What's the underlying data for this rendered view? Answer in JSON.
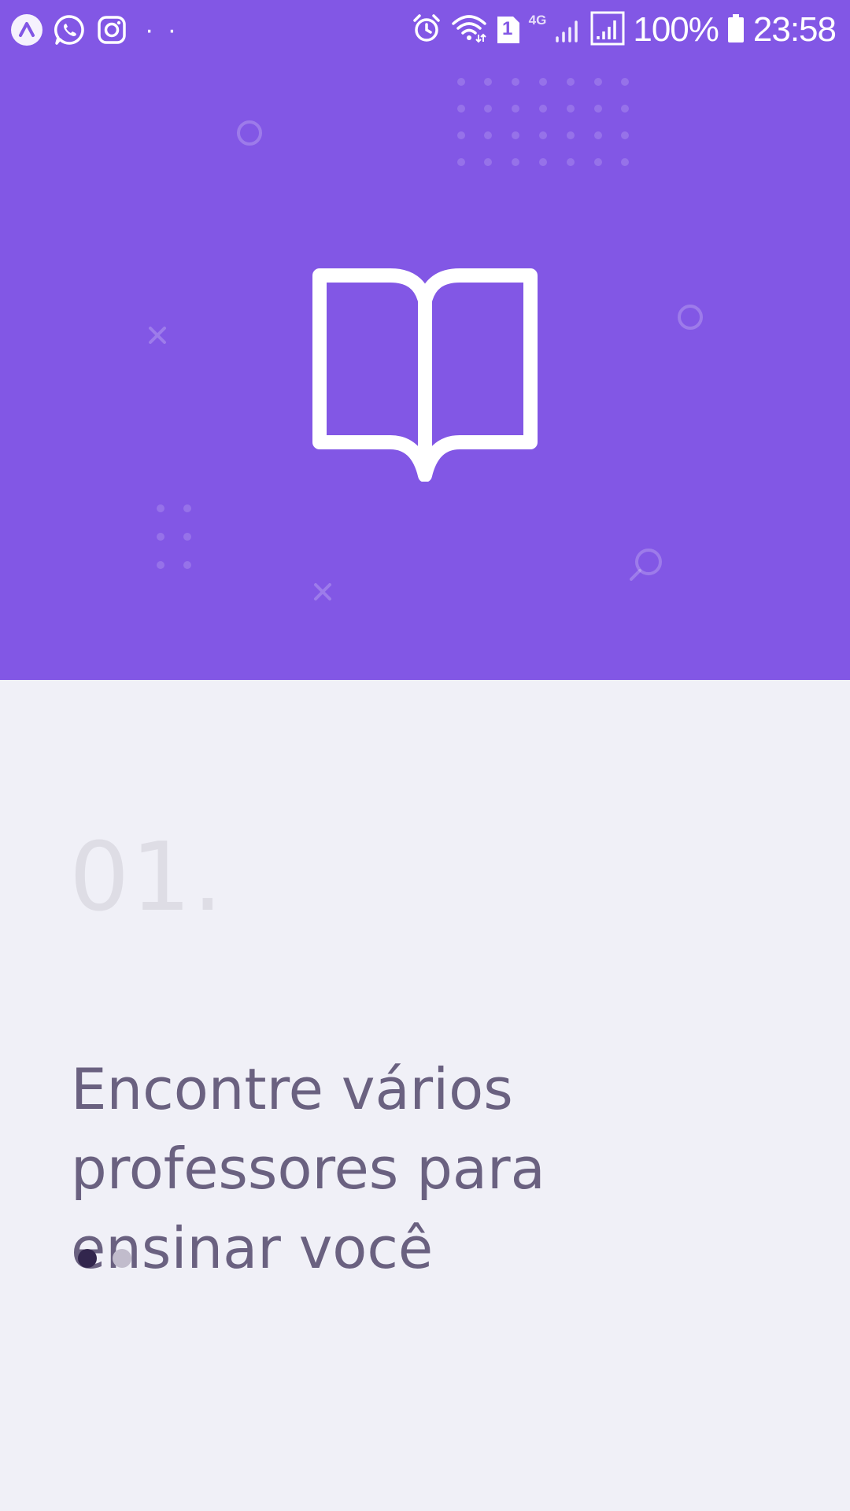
{
  "status_bar": {
    "notification_icons": [
      "expo-icon",
      "whatsapp-icon",
      "instagram-icon"
    ],
    "more_dots": "· ·",
    "network_type": "4G",
    "sim_badge": "1",
    "battery": "100%",
    "time": "23:58"
  },
  "hero": {
    "background_color": "#8257E5",
    "icon": "open-book-icon"
  },
  "onboarding": {
    "page_number": "01.",
    "heading_line1": "Encontre vários",
    "heading_line2": "professores para",
    "heading_line3": "ensinar você",
    "pager": {
      "total": 2,
      "active_index": 0
    }
  },
  "colors": {
    "primary": "#8257E5",
    "background": "#F0F0F7",
    "text": "#6A6180",
    "dot_active": "#32264D",
    "dot_inactive": "#C1BCCC"
  }
}
